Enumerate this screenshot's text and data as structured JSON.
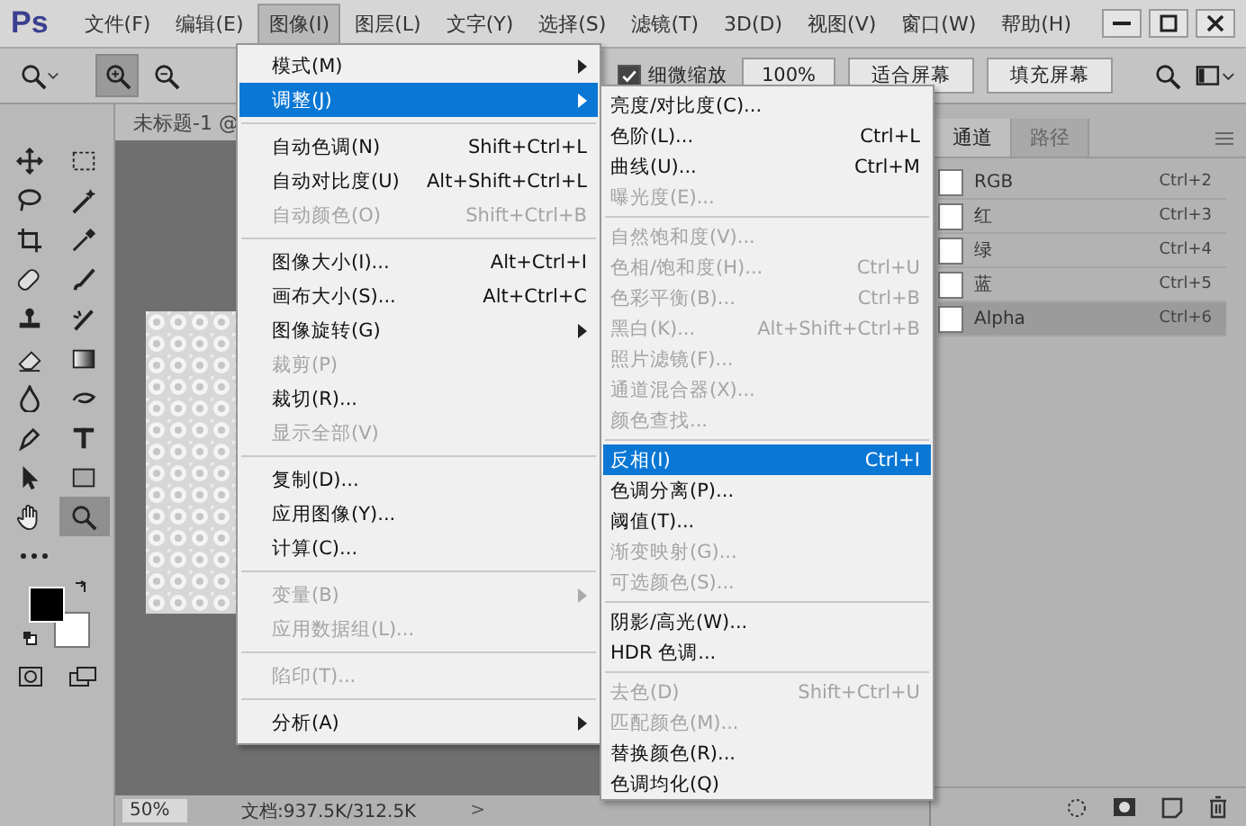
{
  "app": {
    "logo": "Ps"
  },
  "menubar": [
    {
      "label": "文件(F)",
      "selected": false
    },
    {
      "label": "编辑(E)",
      "selected": false
    },
    {
      "label": "图像(I)",
      "selected": true
    },
    {
      "label": "图层(L)",
      "selected": false
    },
    {
      "label": "文字(Y)",
      "selected": false
    },
    {
      "label": "选择(S)",
      "selected": false
    },
    {
      "label": "滤镜(T)",
      "selected": false
    },
    {
      "label": "3D(D)",
      "selected": false
    },
    {
      "label": "视图(V)",
      "selected": false
    },
    {
      "label": "窗口(W)",
      "selected": false
    },
    {
      "label": "帮助(H)",
      "selected": false
    }
  ],
  "options_bar": {
    "tools": [
      {
        "kind": "zoom",
        "selected": false
      },
      {
        "kind": "zoom-in",
        "selected": true
      },
      {
        "kind": "zoom-out",
        "selected": false
      }
    ],
    "scrubby_zoom": {
      "label": "细微缩放",
      "checked": true
    },
    "buttons": [
      "100%",
      "适合屏幕",
      "填充屏幕"
    ]
  },
  "tools": [
    {
      "kind": "move",
      "selected": false
    },
    {
      "kind": "marquee",
      "selected": false
    },
    {
      "kind": "lasso",
      "selected": false
    },
    {
      "kind": "wand",
      "selected": false
    },
    {
      "kind": "crop",
      "selected": false
    },
    {
      "kind": "eyedropper",
      "selected": false
    },
    {
      "kind": "healing",
      "selected": false
    },
    {
      "kind": "brush",
      "selected": false
    },
    {
      "kind": "stamp",
      "selected": false
    },
    {
      "kind": "history",
      "selected": false
    },
    {
      "kind": "eraser",
      "selected": false
    },
    {
      "kind": "gradient",
      "selected": false
    },
    {
      "kind": "blur",
      "selected": false
    },
    {
      "kind": "dodge",
      "selected": false
    },
    {
      "kind": "pen",
      "selected": false
    },
    {
      "kind": "type",
      "selected": false
    },
    {
      "kind": "select",
      "selected": false
    },
    {
      "kind": "rectangle",
      "selected": false
    },
    {
      "kind": "hand",
      "selected": false
    },
    {
      "kind": "zoom",
      "selected": true
    }
  ],
  "document": {
    "tab": "未标题-1 @",
    "zoom": "50%",
    "info": "文档:937.5K/312.5K",
    "arrow": ">"
  },
  "channels_panel": {
    "tabs": [
      {
        "label": "通道",
        "selected": true
      },
      {
        "label": "路径",
        "selected": false
      }
    ],
    "channels": [
      {
        "name": "RGB",
        "shortcut": "Ctrl+2",
        "selected": false
      },
      {
        "name": "红",
        "shortcut": "Ctrl+3",
        "selected": false
      },
      {
        "name": "绿",
        "shortcut": "Ctrl+4",
        "selected": false
      },
      {
        "name": "蓝",
        "shortcut": "Ctrl+5",
        "selected": false
      },
      {
        "name": "Alpha",
        "shortcut": "Ctrl+6",
        "selected": true
      }
    ]
  },
  "image_menu": [
    {
      "kind": "item",
      "label": "模式(M)",
      "submenu": true,
      "disabled": false,
      "selected": false
    },
    {
      "kind": "item",
      "label": "调整(J)",
      "submenu": true,
      "disabled": false,
      "selected": true
    },
    {
      "kind": "separator"
    },
    {
      "kind": "item",
      "label": "自动色调(N)",
      "shortcut": "Shift+Ctrl+L",
      "submenu": false,
      "disabled": false,
      "selected": false
    },
    {
      "kind": "item",
      "label": "自动对比度(U)",
      "shortcut": "Alt+Shift+Ctrl+L",
      "submenu": false,
      "disabled": false,
      "selected": false
    },
    {
      "kind": "item",
      "label": "自动颜色(O)",
      "shortcut": "Shift+Ctrl+B",
      "submenu": false,
      "disabled": true,
      "selected": false
    },
    {
      "kind": "separator"
    },
    {
      "kind": "item",
      "label": "图像大小(I)...",
      "shortcut": "Alt+Ctrl+I",
      "submenu": false,
      "disabled": false,
      "selected": false
    },
    {
      "kind": "item",
      "label": "画布大小(S)...",
      "shortcut": "Alt+Ctrl+C",
      "submenu": false,
      "disabled": false,
      "selected": false
    },
    {
      "kind": "item",
      "label": "图像旋转(G)",
      "submenu": true,
      "disabled": false,
      "selected": false
    },
    {
      "kind": "item",
      "label": "裁剪(P)",
      "submenu": false,
      "disabled": true,
      "selected": false
    },
    {
      "kind": "item",
      "label": "裁切(R)...",
      "submenu": false,
      "disabled": false,
      "selected": false
    },
    {
      "kind": "item",
      "label": "显示全部(V)",
      "submenu": false,
      "disabled": true,
      "selected": false
    },
    {
      "kind": "separator"
    },
    {
      "kind": "item",
      "label": "复制(D)...",
      "submenu": false,
      "disabled": false,
      "selected": false
    },
    {
      "kind": "item",
      "label": "应用图像(Y)...",
      "submenu": false,
      "disabled": false,
      "selected": false
    },
    {
      "kind": "item",
      "label": "计算(C)...",
      "submenu": false,
      "disabled": false,
      "selected": false
    },
    {
      "kind": "separator"
    },
    {
      "kind": "item",
      "label": "变量(B)",
      "submenu": true,
      "disabled": true,
      "selected": false
    },
    {
      "kind": "item",
      "label": "应用数据组(L)...",
      "submenu": false,
      "disabled": true,
      "selected": false
    },
    {
      "kind": "separator"
    },
    {
      "kind": "item",
      "label": "陷印(T)...",
      "submenu": false,
      "disabled": true,
      "selected": false
    },
    {
      "kind": "separator"
    },
    {
      "kind": "item",
      "label": "分析(A)",
      "submenu": true,
      "disabled": false,
      "selected": false
    }
  ],
  "adjust_menu": [
    {
      "kind": "item",
      "label": "亮度/对比度(C)...",
      "disabled": false,
      "selected": false
    },
    {
      "kind": "item",
      "label": "色阶(L)...",
      "shortcut": "Ctrl+L",
      "disabled": false,
      "selected": false
    },
    {
      "kind": "item",
      "label": "曲线(U)...",
      "shortcut": "Ctrl+M",
      "disabled": false,
      "selected": false
    },
    {
      "kind": "item",
      "label": "曝光度(E)...",
      "disabled": true,
      "selected": false
    },
    {
      "kind": "separator"
    },
    {
      "kind": "item",
      "label": "自然饱和度(V)...",
      "disabled": true,
      "selected": false
    },
    {
      "kind": "item",
      "label": "色相/饱和度(H)...",
      "shortcut": "Ctrl+U",
      "disabled": true,
      "selected": false
    },
    {
      "kind": "item",
      "label": "色彩平衡(B)...",
      "shortcut": "Ctrl+B",
      "disabled": true,
      "selected": false
    },
    {
      "kind": "item",
      "label": "黑白(K)...",
      "shortcut": "Alt+Shift+Ctrl+B",
      "disabled": true,
      "selected": false
    },
    {
      "kind": "item",
      "label": "照片滤镜(F)...",
      "disabled": true,
      "selected": false
    },
    {
      "kind": "item",
      "label": "通道混合器(X)...",
      "disabled": true,
      "selected": false
    },
    {
      "kind": "item",
      "label": "颜色查找...",
      "disabled": true,
      "selected": false
    },
    {
      "kind": "separator"
    },
    {
      "kind": "item",
      "label": "反相(I)",
      "shortcut": "Ctrl+I",
      "disabled": false,
      "selected": true
    },
    {
      "kind": "item",
      "label": "色调分离(P)...",
      "disabled": false,
      "selected": false
    },
    {
      "kind": "item",
      "label": "阈值(T)...",
      "disabled": false,
      "selected": false
    },
    {
      "kind": "item",
      "label": "渐变映射(G)...",
      "disabled": true,
      "selected": false
    },
    {
      "kind": "item",
      "label": "可选颜色(S)...",
      "disabled": true,
      "selected": false
    },
    {
      "kind": "separator"
    },
    {
      "kind": "item",
      "label": "阴影/高光(W)...",
      "disabled": false,
      "selected": false
    },
    {
      "kind": "item",
      "label": "HDR 色调...",
      "disabled": false,
      "selected": false
    },
    {
      "kind": "separator"
    },
    {
      "kind": "item",
      "label": "去色(D)",
      "shortcut": "Shift+Ctrl+U",
      "disabled": true,
      "selected": false
    },
    {
      "kind": "item",
      "label": "匹配颜色(M)...",
      "disabled": true,
      "selected": false
    },
    {
      "kind": "item",
      "label": "替换颜色(R)...",
      "disabled": false,
      "selected": false
    },
    {
      "kind": "item",
      "label": "色调均化(Q)",
      "disabled": false,
      "selected": false
    }
  ]
}
